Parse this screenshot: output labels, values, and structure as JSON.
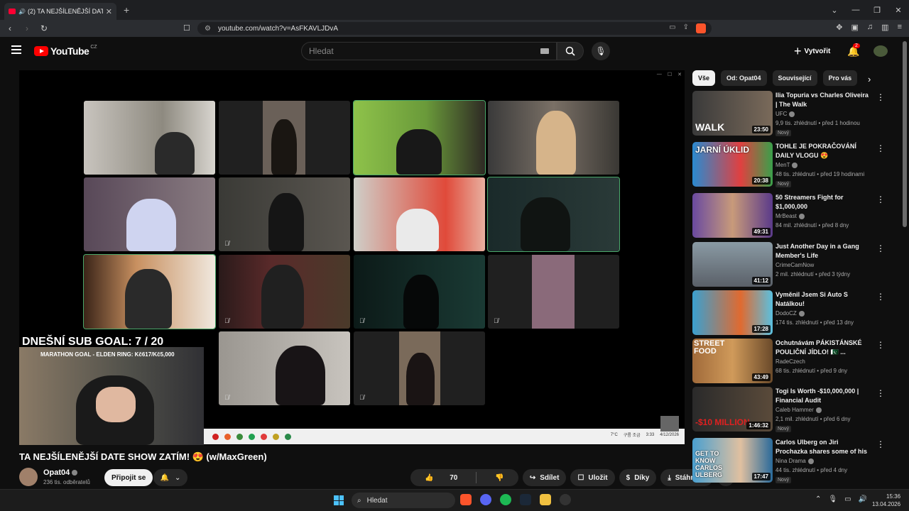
{
  "browser": {
    "tab_title": "(2) TA NEJŠÍLENĚJŠÍ DATE SHOW ZATÍM! (w/MaxGreen)",
    "tab_title_display": "(2) TA NEJŠÍLENĚJŠÍ DATE SH",
    "url": "youtube.com/watch?v=AsFKAVLJDvA"
  },
  "header": {
    "logo": "YouTube",
    "region": "CZ",
    "search_placeholder": "Hledat",
    "create_label": "Vytvořit",
    "notif_count": "2"
  },
  "video": {
    "overlay_subgoal": "DNEŠNÍ SUB GOAL: 7 / 20",
    "overlay_marathon": "MARATHON GOAL - ELDEN RING: Kč617/Kč5,000",
    "stream_weather": "7°C",
    "stream_weather_sub": "구름 조금",
    "stream_date": "4/12/2026",
    "stream_time": "3:33",
    "title": "TA NEJŠÍLENĚJŠÍ DATE SHOW ZATÍM! 😍 (w/MaxGreen)",
    "channel": "Opat04",
    "subscribers": "236 tis. odběratelů",
    "join_label": "Připojit se",
    "likes": "70",
    "share_label": "Sdílet",
    "save_label": "Uložit",
    "thanks_label": "Díky",
    "download_label": "Stáhnout"
  },
  "chips": [
    "Vše",
    "Od: Opat04",
    "Související",
    "Pro vás"
  ],
  "recommendations": [
    {
      "title": "Ilia Topuria vs Charles Oliveira | The Walk",
      "channel": "UFC",
      "meta": "9,9 tis. zhlédnutí • před 1 hodinou",
      "duration": "23:50",
      "badge": "Nový",
      "thumb_text": "WALK"
    },
    {
      "title": "TOHLE JE POKRAČOVÁNÍ DAILY VLOGU 😍",
      "channel": "MenT",
      "meta": "48 tis. zhlédnutí • před 19 hodinami",
      "duration": "20:38",
      "badge": "Nový",
      "thumb_text": "JARNÍ ÚKLID"
    },
    {
      "title": "50 Streamers Fight for $1,000,000",
      "channel": "MrBeast",
      "meta": "84 mil. zhlédnutí • před 8 dny",
      "duration": "49:31",
      "badge": "",
      "thumb_text": ""
    },
    {
      "title": "Just Another Day in a Gang Member's Life",
      "channel": "CrimeCamNow",
      "meta": "2 mil. zhlédnutí • před 3 týdny",
      "duration": "41:12",
      "badge": "",
      "thumb_text": ""
    },
    {
      "title": "Vyměnil Jsem Si Auto S Natálkou!",
      "channel": "DodoCZ",
      "meta": "174 tis. zhlédnutí • před 13 dny",
      "duration": "17:28",
      "badge": "",
      "thumb_text": ""
    },
    {
      "title": "Ochutnávám PÁKISTÁNSKÉ POULIČNÍ JÍDLO! 🇵🇰 ...",
      "channel": "RadeCzech",
      "meta": "68 tis. zhlédnutí • před 9 dny",
      "duration": "43:49",
      "badge": "",
      "thumb_text": "STREET FOOD"
    },
    {
      "title": "Togi Is Worth -$10,000,000 | Financial Audit",
      "channel": "Caleb Hammer",
      "meta": "2,1 mil. zhlédnutí • před 6 dny",
      "duration": "1:46:32",
      "badge": "Nový",
      "thumb_text": "-$10 MILLION"
    },
    {
      "title": "Carlos Ulberg on Jiri Prochazka shares some of his funniest ...",
      "channel": "Nina Drama",
      "meta": "44 tis. zhlédnutí • před 4 dny",
      "duration": "17:47",
      "badge": "Nový",
      "thumb_text": "GET TO KNOW CARLOS ULBERG"
    }
  ],
  "taskbar": {
    "search_label": "Hledat",
    "time": "15:36",
    "date": "13.04.2026",
    "discord_badge": "1"
  },
  "colors": {
    "yt_red": "#ff0000",
    "bg": "#0f0f0f",
    "highlight_tile": "#4aa86a"
  }
}
